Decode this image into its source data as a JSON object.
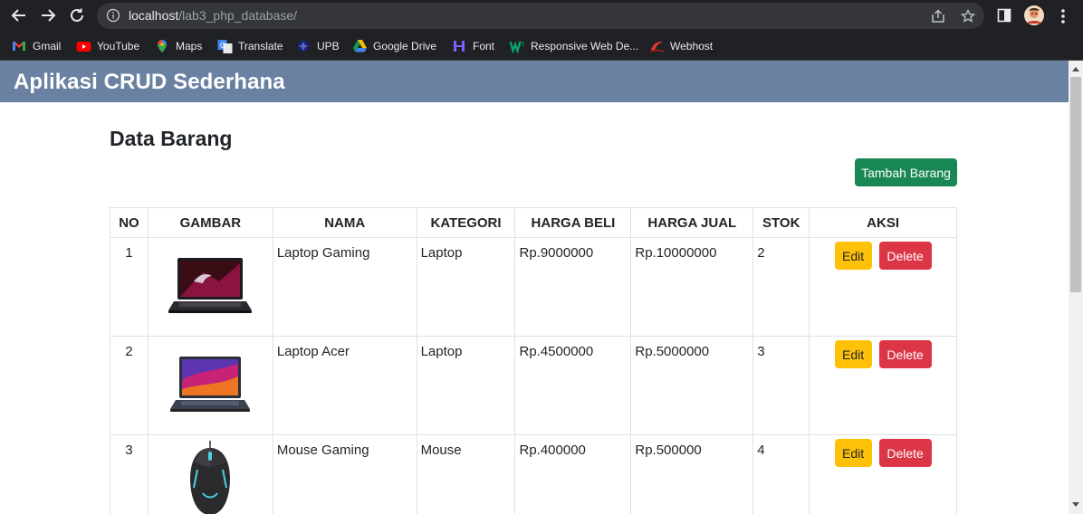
{
  "browser": {
    "url_host": "localhost",
    "url_path": "/lab3_php_database/",
    "bookmarks": [
      {
        "label": "Gmail",
        "icon": "gmail-icon"
      },
      {
        "label": "YouTube",
        "icon": "youtube-icon"
      },
      {
        "label": "Maps",
        "icon": "maps-icon"
      },
      {
        "label": "Translate",
        "icon": "translate-icon"
      },
      {
        "label": "UPB",
        "icon": "upb-icon"
      },
      {
        "label": "Google Drive",
        "icon": "google-drive-icon"
      },
      {
        "label": "Font",
        "icon": "font-icon"
      },
      {
        "label": "Responsive Web De...",
        "icon": "responsive-web-icon"
      },
      {
        "label": "Webhost",
        "icon": "webhost-icon"
      }
    ]
  },
  "app": {
    "header_title": "Aplikasi CRUD Sederhana",
    "page_title": "Data Barang",
    "add_button": "Tambah Barang"
  },
  "table": {
    "headers": [
      "NO",
      "GAMBAR",
      "NAMA",
      "KATEGORI",
      "HARGA BELI",
      "HARGA JUAL",
      "STOK",
      "AKSI"
    ],
    "rows": [
      {
        "no": "1",
        "image": "laptop-gaming-image",
        "nama": "Laptop Gaming",
        "kategori": "Laptop",
        "harga_beli": "Rp.9000000",
        "harga_jual": "Rp.10000000",
        "stok": "2",
        "edit": "Edit",
        "delete": "Delete"
      },
      {
        "no": "2",
        "image": "laptop-acer-image",
        "nama": "Laptop Acer",
        "kategori": "Laptop",
        "harga_beli": "Rp.4500000",
        "harga_jual": "Rp.5000000",
        "stok": "3",
        "edit": "Edit",
        "delete": "Delete"
      },
      {
        "no": "3",
        "image": "mouse-gaming-image",
        "nama": "Mouse Gaming",
        "kategori": "Mouse",
        "harga_beli": "Rp.400000",
        "harga_jual": "Rp.500000",
        "stok": "4",
        "edit": "Edit",
        "delete": "Delete"
      }
    ]
  },
  "colors": {
    "header_bg": "#6a81a1",
    "add_button": "#198754",
    "edit_button": "#ffc107",
    "delete_button": "#dc3545"
  }
}
